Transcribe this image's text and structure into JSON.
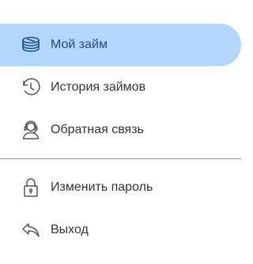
{
  "menu": {
    "items": [
      {
        "label": "Мой займ",
        "icon": "stack-icon",
        "active": true
      },
      {
        "label": "История займов",
        "icon": "history-icon",
        "active": false
      },
      {
        "label": "Обратная связь",
        "icon": "support-icon",
        "active": false
      },
      {
        "label": "Изменить пароль",
        "icon": "lock-icon",
        "active": false
      },
      {
        "label": "Выход",
        "icon": "logout-icon",
        "active": false
      }
    ]
  },
  "colors": {
    "active_background": "#b3d7fb",
    "active_text": "#1a4f86",
    "text": "#333333",
    "divider": "#9a9a9a"
  }
}
